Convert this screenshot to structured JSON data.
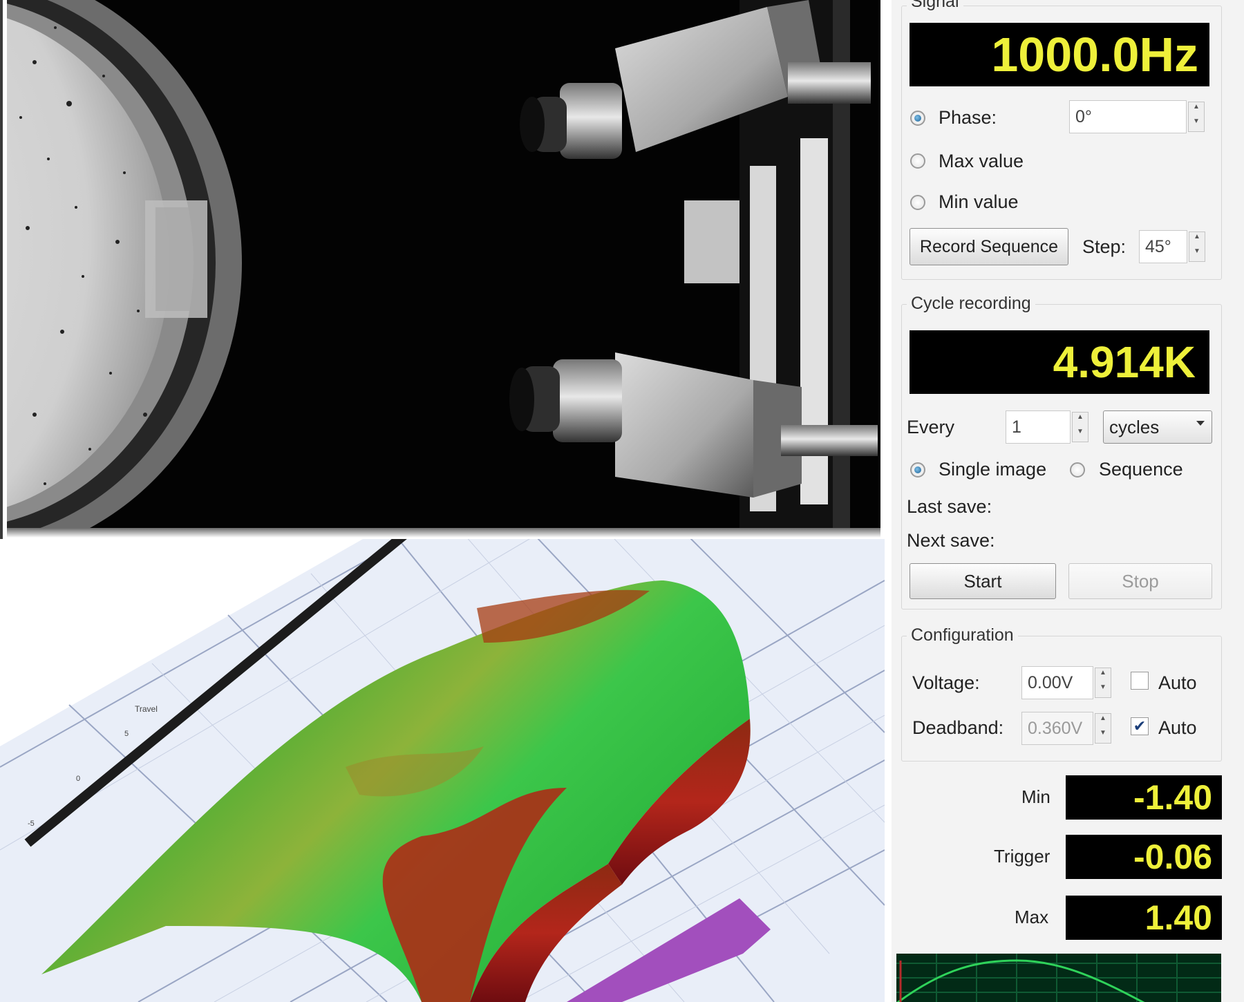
{
  "signal": {
    "group_title": "Signal",
    "frequency": "1000.0Hz",
    "phase_label": "Phase:",
    "phase_value": "0°",
    "max_value_label": "Max value",
    "min_value_label": "Min value",
    "record_sequence_label": "Record Sequence",
    "step_label": "Step:",
    "step_value": "45°",
    "selected_mode": "phase"
  },
  "cycle_recording": {
    "group_title": "Cycle recording",
    "count": "4.914K",
    "every_label": "Every",
    "every_value": "1",
    "unit_selected": "cycles",
    "single_image_label": "Single image",
    "sequence_label": "Sequence",
    "selected_mode": "single",
    "last_save_label": "Last save:",
    "next_save_label": "Next save:",
    "start_label": "Start",
    "stop_label": "Stop"
  },
  "configuration": {
    "group_title": "Configuration",
    "voltage_label": "Voltage:",
    "voltage_value": "0.00V",
    "voltage_auto_label": "Auto",
    "voltage_auto_checked": false,
    "deadband_label": "Deadband:",
    "deadband_value": "0.360V",
    "deadband_auto_label": "Auto",
    "deadband_auto_checked": true
  },
  "readouts": {
    "min_label": "Min",
    "min_value": "-1.40",
    "trigger_label": "Trigger",
    "trigger_value": "-0.06",
    "max_label": "Max",
    "max_value": "1.40"
  },
  "colors": {
    "lcd_background": "#000000",
    "lcd_text": "#eef03a",
    "scope_background": "#022a16",
    "scope_trace": "#2fd35a",
    "surface_high": "#2fbf3f",
    "surface_low": "#a8121a",
    "panel_background": "#f3f3f3"
  }
}
